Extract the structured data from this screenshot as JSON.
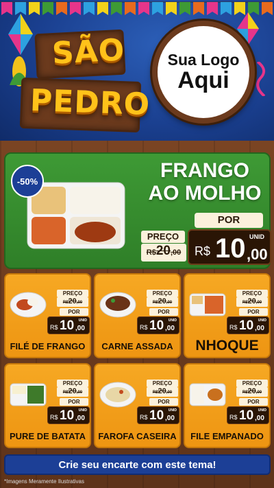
{
  "header": {
    "title_line1": "SÃO",
    "title_line2": "PEDRO",
    "logo_line1": "Sua Logo",
    "logo_line2": "Aqui"
  },
  "featured": {
    "discount": "-50%",
    "title_line1": "FRANGO",
    "title_line2": "AO MOLHO",
    "preco_label": "PREÇO",
    "por_label": "POR",
    "unid_label": "UNID",
    "old_currency": "R$",
    "old_int": "20",
    "old_dec": ",00",
    "new_currency": "R$",
    "new_int": "10",
    "new_dec": ",00"
  },
  "price_labels": {
    "preco": "PREÇO",
    "por": "POR",
    "unid": "UNID",
    "currency": "R$"
  },
  "products": [
    {
      "name": "FILÉ DE FRANGO",
      "old_int": "20",
      "old_dec": ",00",
      "new_int": "10",
      "new_dec": ",00"
    },
    {
      "name": "CARNE ASSADA",
      "old_int": "20",
      "old_dec": ",00",
      "new_int": "10",
      "new_dec": ",00"
    },
    {
      "name": "NHOQUE",
      "old_int": "20",
      "old_dec": ",00",
      "new_int": "10",
      "new_dec": ",00"
    },
    {
      "name": "PURE DE BATATA",
      "old_int": "20",
      "old_dec": ",00",
      "new_int": "10",
      "new_dec": ",00"
    },
    {
      "name": "FAROFA CASEIRA",
      "old_int": "20",
      "old_dec": ",00",
      "new_int": "10",
      "new_dec": ",00"
    },
    {
      "name": "FILE EMPANADO",
      "old_int": "20",
      "old_dec": ",00",
      "new_int": "10",
      "new_dec": ",00"
    }
  ],
  "cta": {
    "label": "Crie seu encarte com este tema!"
  },
  "footer": {
    "disclaimer": "*Imagens Meramente Ilustrativas"
  },
  "colors": {
    "header_blue": "#1a3f8f",
    "featured_green": "#3e9a35",
    "card_orange": "#f6a823",
    "cta_blue": "#1c3f96",
    "wood": "#6b3a1d",
    "title_yellow": "#ffc21a"
  }
}
